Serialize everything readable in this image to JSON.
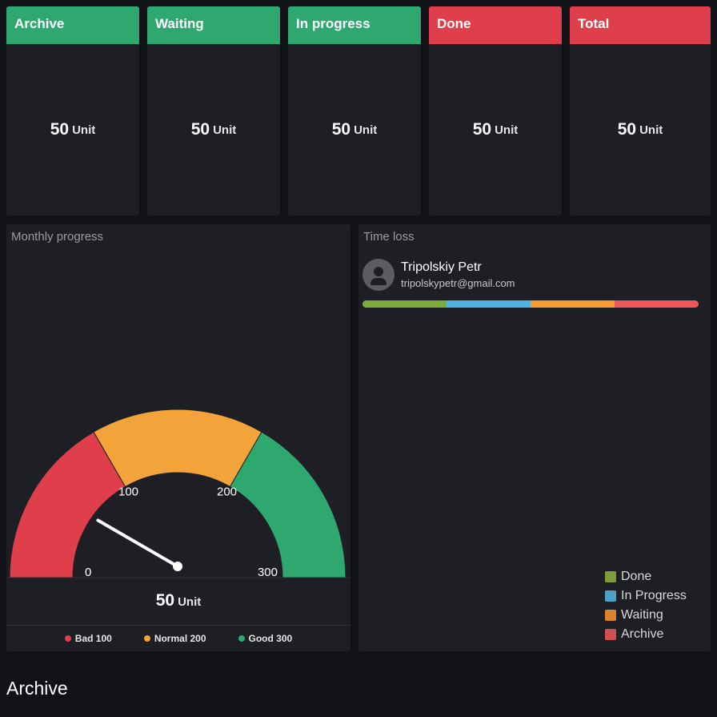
{
  "stat_cards": [
    {
      "title": "Archive",
      "value": "50",
      "unit": "Unit",
      "color": "#2ea86f"
    },
    {
      "title": "Waiting",
      "value": "50",
      "unit": "Unit",
      "color": "#2ea86f"
    },
    {
      "title": "In progress",
      "value": "50",
      "unit": "Unit",
      "color": "#2ea86f"
    },
    {
      "title": "Done",
      "value": "50",
      "unit": "Unit",
      "color": "#de3f4a"
    },
    {
      "title": "Total",
      "value": "50",
      "unit": "Unit",
      "color": "#de3f4a"
    }
  ],
  "monthly_progress": {
    "title": "Monthly progress",
    "value": "50",
    "unit": "Unit",
    "needle_value": 50,
    "min": 0,
    "max": 300,
    "ticks": [
      "0",
      "100",
      "200",
      "300"
    ],
    "bands": [
      {
        "label": "Bad 100",
        "from": 0,
        "to": 100,
        "color": "#de3f4a"
      },
      {
        "label": "Normal 200",
        "from": 100,
        "to": 200,
        "color": "#f2a33a"
      },
      {
        "label": "Good 300",
        "from": 200,
        "to": 300,
        "color": "#2ea86f"
      }
    ]
  },
  "time_loss": {
    "title": "Time loss",
    "user_name": "Tripolskiy Petr",
    "user_email": "tripolskypetr@gmail.com",
    "avatar_icon": "person-icon",
    "segments": [
      {
        "label": "Done",
        "fraction": 0.25,
        "color": "#7eab3c"
      },
      {
        "label": "In Progress",
        "fraction": 0.25,
        "color": "#4fb5e0"
      },
      {
        "label": "Waiting",
        "fraction": 0.25,
        "color": "#f79a33"
      },
      {
        "label": "Archive",
        "fraction": 0.25,
        "color": "#f0575a"
      }
    ],
    "legend": [
      {
        "label": "Done",
        "color": "#7e9d3a"
      },
      {
        "label": "In Progress",
        "color": "#4ba1c8"
      },
      {
        "label": "Waiting",
        "color": "#d9832c"
      },
      {
        "label": "Archive",
        "color": "#d05050"
      }
    ]
  },
  "section": {
    "title": "Archive"
  }
}
